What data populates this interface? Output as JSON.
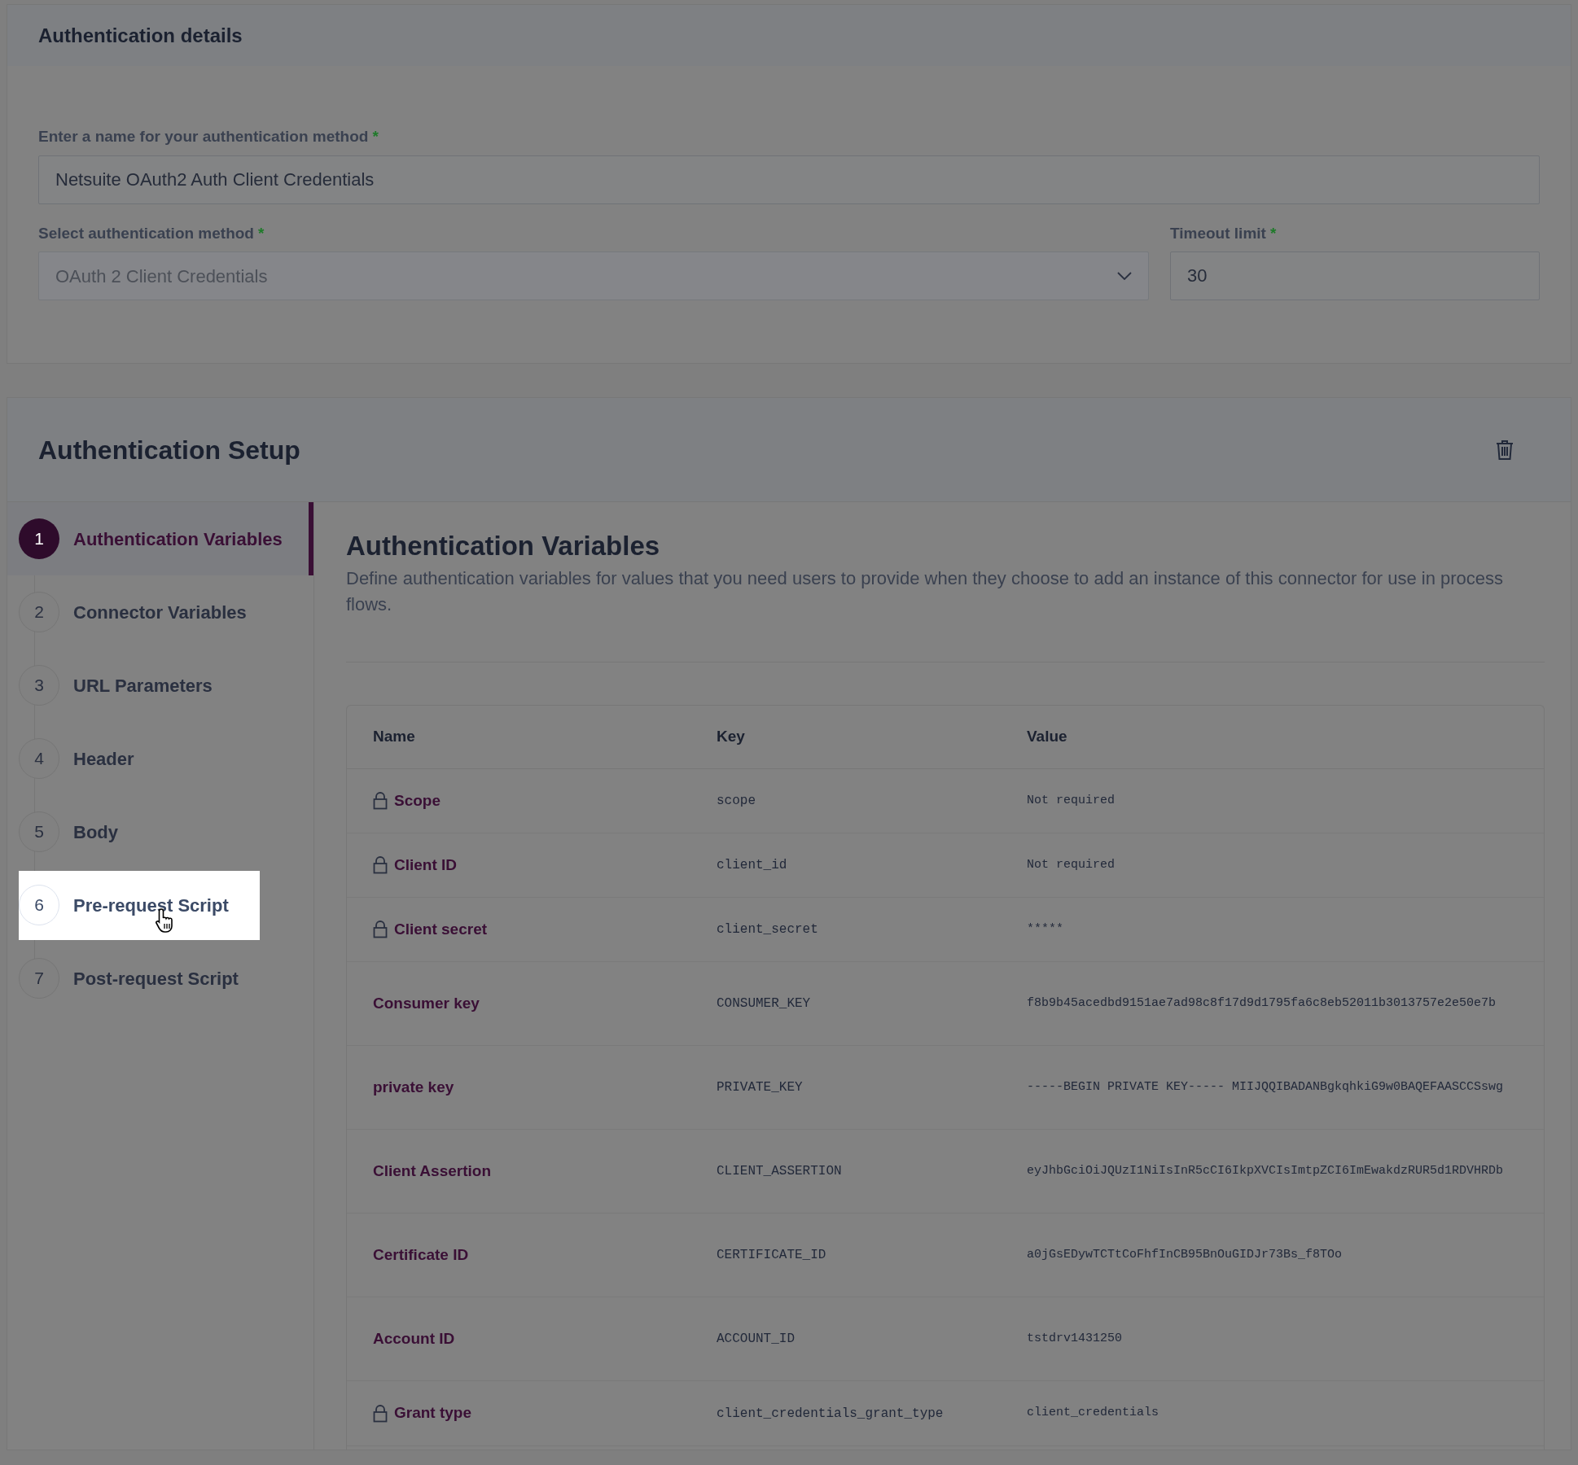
{
  "details": {
    "title": "Authentication details",
    "name_field": {
      "label": "Enter a name for your authentication method",
      "required_mark": "*",
      "value": "Netsuite OAuth2 Auth Client Credentials"
    },
    "method_field": {
      "label": "Select authentication method",
      "required_mark": "*",
      "value": "OAuth 2 Client Credentials",
      "disabled": true
    },
    "timeout_field": {
      "label": "Timeout limit",
      "required_mark": "*",
      "value": "30"
    }
  },
  "setup": {
    "title": "Authentication Setup",
    "steps": [
      {
        "number": "1",
        "label": "Authentication Variables",
        "selected": true,
        "highlighted": false
      },
      {
        "number": "2",
        "label": "Connector Variables",
        "selected": false,
        "highlighted": false
      },
      {
        "number": "3",
        "label": "URL Parameters",
        "selected": false,
        "highlighted": false
      },
      {
        "number": "4",
        "label": "Header",
        "selected": false,
        "highlighted": false
      },
      {
        "number": "5",
        "label": "Body",
        "selected": false,
        "highlighted": false
      },
      {
        "number": "6",
        "label": "Pre-request Script",
        "selected": false,
        "highlighted": true
      },
      {
        "number": "7",
        "label": "Post-request Script",
        "selected": false,
        "highlighted": false
      }
    ],
    "content": {
      "title": "Authentication Variables",
      "description": "Define authentication variables for values that you need users to provide when they choose to add an instance of this connector for use in process flows.",
      "table": {
        "columns": [
          "Name",
          "Key",
          "Value"
        ],
        "rows": [
          {
            "name": "Scope",
            "key": "scope",
            "value": "Not required",
            "locked": true
          },
          {
            "name": "Client ID",
            "key": "client_id",
            "value": "Not required",
            "locked": true
          },
          {
            "name": "Client secret",
            "key": "client_secret",
            "value": "*****",
            "locked": true
          },
          {
            "name": "Consumer key",
            "key": "CONSUMER_KEY",
            "value": "f8b9b45acedbd9151ae7ad98c8f17d9d1795fa6c8eb52011b3013757e2e50e7b",
            "locked": false
          },
          {
            "name": "private key",
            "key": "PRIVATE_KEY",
            "value": "-----BEGIN PRIVATE KEY----- MIIJQQIBADANBgkqhkiG9w0BAQEFAASCCSswg",
            "locked": false
          },
          {
            "name": "Client Assertion",
            "key": "CLIENT_ASSERTION",
            "value": "eyJhbGciOiJQUzI1NiIsInR5cCI6IkpXVCIsImtpZCI6ImEwakdzRUR5d1RDVHRDb",
            "locked": false
          },
          {
            "name": "Certificate ID",
            "key": "CERTIFICATE_ID",
            "value": "a0jGsEDywTCTtCoFhfInCB95BnOuGIDJr73Bs_f8TOo",
            "locked": false
          },
          {
            "name": "Account ID",
            "key": "ACCOUNT_ID",
            "value": "tstdrv1431250",
            "locked": false
          },
          {
            "name": "Grant type",
            "key": "client_credentials_grant_type",
            "value": "client_credentials",
            "locked": true
          }
        ]
      }
    }
  }
}
